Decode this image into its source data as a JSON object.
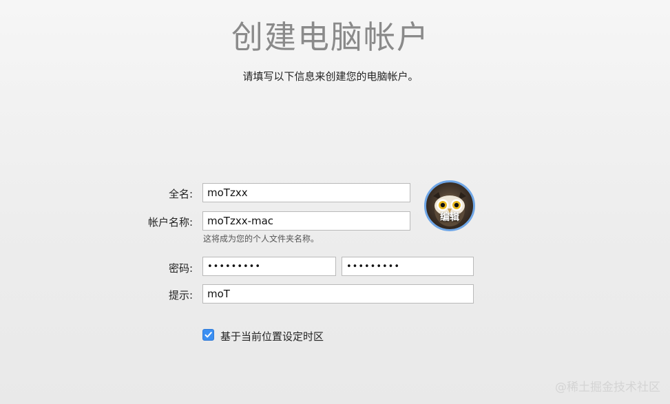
{
  "header": {
    "title": "创建电脑帐户",
    "subtitle": "请填写以下信息来创建您的电脑帐户。"
  },
  "form": {
    "full_name": {
      "label": "全名:",
      "value": "moTzxx"
    },
    "account_name": {
      "label": "帐户名称:",
      "value": "moTzxx-mac",
      "helper": "这将成为您的个人文件夹名称。"
    },
    "password": {
      "label": "密码:",
      "value": "•••••••••",
      "verify_value": "•••••••••"
    },
    "hint": {
      "label": "提示:",
      "value": "moT"
    },
    "timezone_checkbox": {
      "label": "基于当前位置设定时区",
      "checked": true
    }
  },
  "avatar": {
    "edit_label": "编辑",
    "image": "owl-icon",
    "ring_color": "#6fa6e6"
  },
  "watermark": {
    "text": "@稀土掘金技术社区"
  },
  "colors": {
    "accent": "#3b8ff2"
  }
}
